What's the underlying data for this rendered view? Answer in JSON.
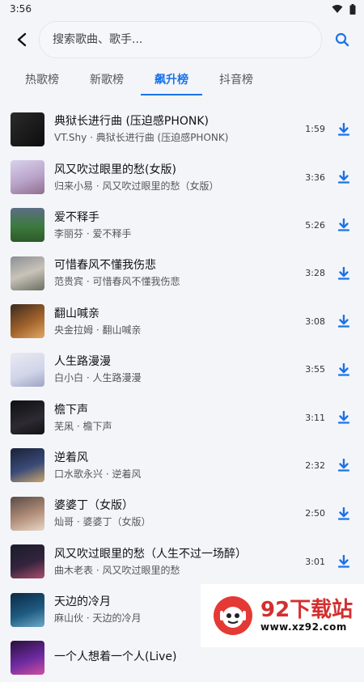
{
  "status": {
    "time": "3:56",
    "icons": [
      "wifi-icon",
      "battery-icon"
    ]
  },
  "search": {
    "placeholder": "搜索歌曲、歌手..."
  },
  "tabs": [
    {
      "label": "热歌榜"
    },
    {
      "label": "新歌榜"
    },
    {
      "label": "飙升榜"
    },
    {
      "label": "抖音榜"
    }
  ],
  "active_tab": "飙升榜",
  "colors": {
    "accent": "#1a73e8",
    "background": "#f3f5f9"
  },
  "songs": [
    {
      "title": "典狱长进行曲 (压迫感PHONK)",
      "subtitle": "VT.Shy · 典狱长进行曲 (压迫感PHONK)",
      "duration": "1:59"
    },
    {
      "title": "风又吹过眼里的愁(女版)",
      "subtitle": "归来小易 · 风又吹过眼里的愁（女版）",
      "duration": "3:36"
    },
    {
      "title": "爱不释手",
      "subtitle": "李丽芬 · 爱不释手",
      "duration": "5:26"
    },
    {
      "title": "可惜春风不懂我伤悲",
      "subtitle": "范贵宾 · 可惜春风不懂我伤悲",
      "duration": "3:28"
    },
    {
      "title": "翻山喊亲",
      "subtitle": "央金拉姆 · 翻山喊亲",
      "duration": "3:08"
    },
    {
      "title": "人生路漫漫",
      "subtitle": "白小白 · 人生路漫漫",
      "duration": "3:55"
    },
    {
      "title": "檐下声",
      "subtitle": "芜凩 · 檐下声",
      "duration": "3:11"
    },
    {
      "title": "逆着风",
      "subtitle": "口水歌永兴 · 逆着风",
      "duration": "2:32"
    },
    {
      "title": "婆婆丁（女版）",
      "subtitle": "灿哥 · 婆婆丁（女版）",
      "duration": "2:50"
    },
    {
      "title": "风又吹过眼里的愁（人生不过一场醉）",
      "subtitle": "曲木老表 · 风又吹过眼里的愁",
      "duration": "3:01"
    },
    {
      "title": "天边的冷月",
      "subtitle": "麻山伙 · 天边的冷月",
      "duration": ""
    },
    {
      "title": "一个人想着一个人(Live)",
      "subtitle": "",
      "duration": ""
    }
  ],
  "watermark": {
    "title": "92下载站",
    "url": "www.xz92.com"
  }
}
